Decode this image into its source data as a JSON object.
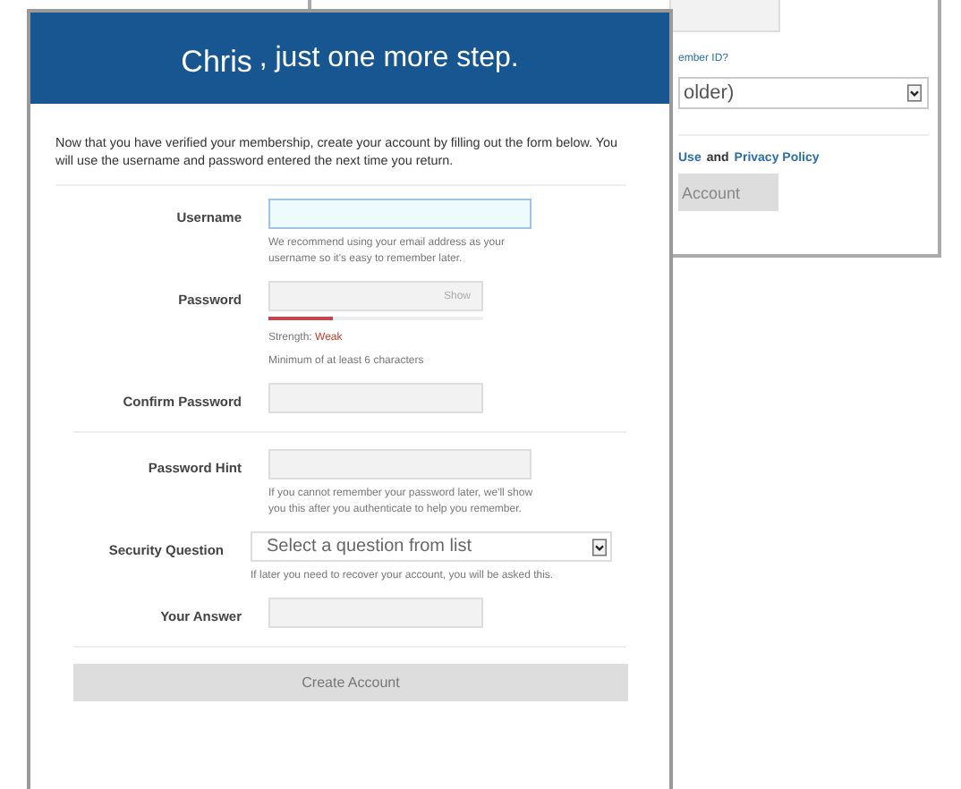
{
  "back_window": {
    "link_text": "ember ID?",
    "select_value": "older)",
    "terms": [
      {
        "text": "Use",
        "kind": "link"
      },
      {
        "text": "and",
        "kind": "text"
      },
      {
        "text": "Privacy Policy",
        "kind": "link"
      }
    ],
    "button": "Account"
  },
  "dialog": {
    "name": "Chris",
    "title": ", just one more step.",
    "intro": "Now that you have verified your membership, create your account by filling out the form below. You will use the username and password entered the next time you return.",
    "fields": [
      {
        "kind": "text",
        "label": "Username",
        "focused": true,
        "help": "We recommend using your email address as your username so it's easy to remember later."
      },
      {
        "kind": "password",
        "label": "Password",
        "focused": false,
        "toggle": "Show",
        "level": 0.3,
        "strength_label": "Strength:",
        "strength_value": "Weak",
        "help": "Minimum of at least 6 characters"
      },
      {
        "kind": "text",
        "label": "Confirm Password",
        "focused": false
      },
      {
        "kind": "divider"
      },
      {
        "kind": "wide",
        "label": "Password Hint",
        "focused": false,
        "help": "If you cannot remember your password later, we'll show you this after you authenticate to help you remember."
      },
      {
        "kind": "select",
        "label": "Security Question",
        "placeholder": "Select a question from list",
        "help": "If later you need to recover your account, you will be asked this."
      },
      {
        "kind": "text",
        "label": "Your Answer",
        "focused": false
      }
    ],
    "submit": "Create Account"
  }
}
